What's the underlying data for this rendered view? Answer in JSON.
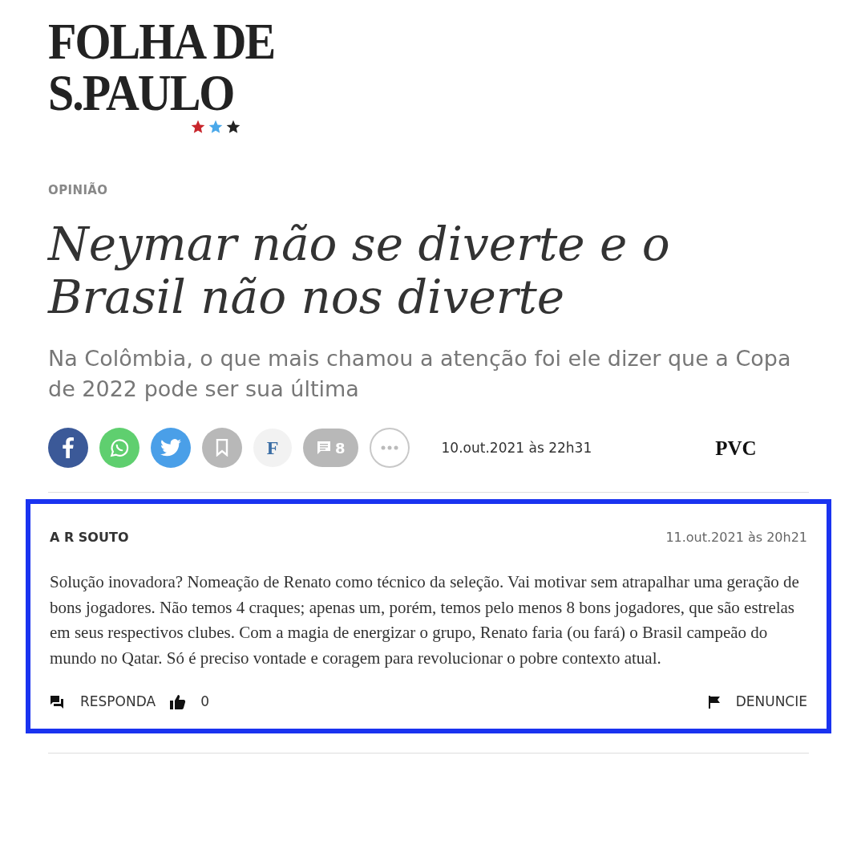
{
  "logo": {
    "title": "FOLHA DE S.PAULO"
  },
  "section": "OPINIÃO",
  "headline": "Neymar não se diverte e o Brasil não nos diverte",
  "subheadline": "Na Colômbia, o que mais chamou a atenção foi ele dizer que a Copa de 2022 pode ser sua última",
  "share": [
    {
      "kind": "facebook"
    },
    {
      "kind": "whatsapp"
    },
    {
      "kind": "twitter"
    },
    {
      "kind": "bookmark"
    },
    {
      "kind": "letter",
      "label": "F"
    },
    {
      "kind": "comments",
      "label": "8"
    },
    {
      "kind": "more"
    }
  ],
  "published": "10.out.2021 às 22h31",
  "author": "PVC",
  "comment": {
    "author": "A R SOUTO",
    "time": "11.out.2021 às 20h21",
    "text": "Solução inovadora? Nomeação de Renato como técnico da seleção. Vai motivar sem atrapalhar uma geração de bons jogadores. Não temos 4 craques; apenas um, porém, temos pelo menos 8 bons jogadores, que são estrelas em seus respectivos clubes. Com a magia de energizar o grupo, Renato faria (ou fará) o Brasil campeão do mundo no Qatar. Só é preciso vontade e coragem para revolucionar o pobre contexto atual.",
    "reply": "RESPONDA",
    "likes": "0",
    "report": "DENUNCIE"
  }
}
